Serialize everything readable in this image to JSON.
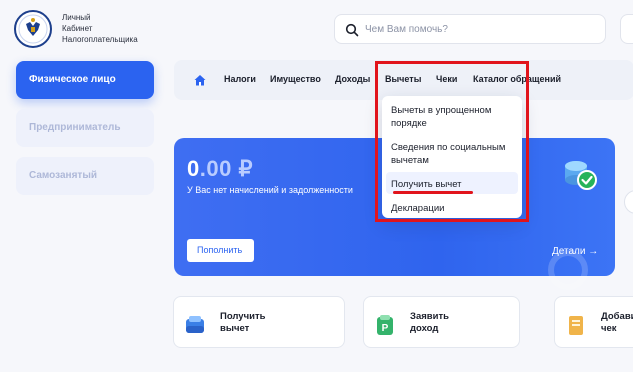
{
  "header": {
    "brand_lines": [
      "Личный",
      "Кабинет",
      "Налогоплательщика"
    ],
    "search_placeholder": "Чем Вам помочь?"
  },
  "sidebar": {
    "items": [
      {
        "label": "Физическое лицо",
        "active": true
      },
      {
        "label": "Предприниматель",
        "active": false
      },
      {
        "label": "Самозанятый",
        "active": false
      }
    ]
  },
  "nav": {
    "items": [
      "Налоги",
      "Имущество",
      "Доходы",
      "Вычеты",
      "Чеки",
      "Каталог обращений"
    ]
  },
  "dropdown": {
    "items": [
      "Вычеты в упрощенном порядке",
      "Сведения по социальным вычетам",
      "Получить вычет",
      "Декларации"
    ],
    "highlighted": "Получить вычет"
  },
  "balance": {
    "amount_int": "0",
    "amount_dec": ".00",
    "currency": "₽",
    "note": "У Вас нет начислений и задолженности",
    "pay_button": "Пополнить",
    "details_link": "Детали",
    "details_arrow": "→"
  },
  "tiles": [
    {
      "line1": "Получить",
      "line2": "вычет",
      "icon": "deduction-icon"
    },
    {
      "line1": "Заявить",
      "line2": "доход",
      "icon": "income-icon"
    },
    {
      "line1": "Добави",
      "line2": "чек",
      "icon": "receipt-icon"
    }
  ],
  "colors": {
    "accent": "#2b63f0",
    "highlight_red": "#e1141c"
  }
}
